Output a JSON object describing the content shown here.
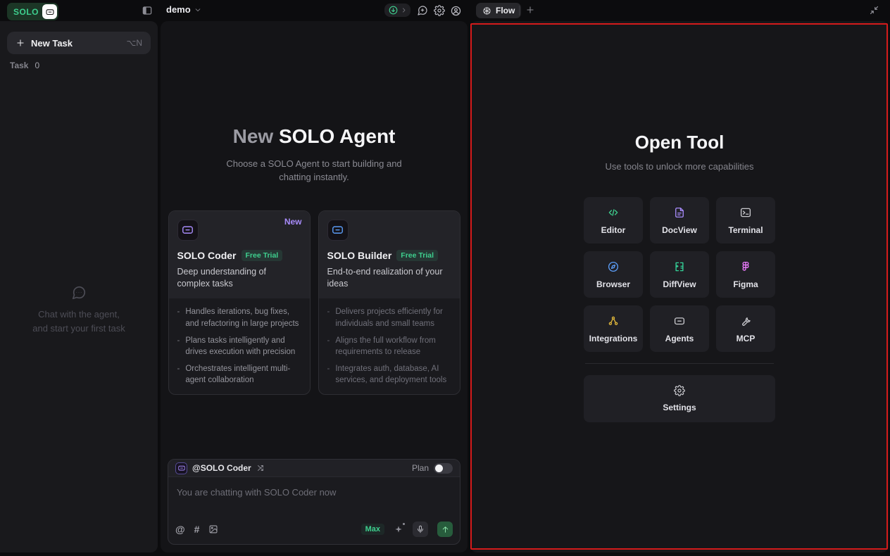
{
  "colors": {
    "accent_green": "#3ecf8e",
    "accent_purple": "#a78bfa",
    "accent_blue": "#5b9cf6",
    "highlight_red": "#d41b1b",
    "notification_blue": "#3b82f6"
  },
  "topbar": {
    "logo_text": "SOLO",
    "project_name": "demo"
  },
  "sidebar": {
    "new_task_label": "New Task",
    "new_task_shortcut": "⌥N",
    "task_label": "Task",
    "task_count": "0",
    "empty_line1": "Chat with the agent,",
    "empty_line2": "and start your first task"
  },
  "main": {
    "title_prefix": "New",
    "title_rest": "SOLO Agent",
    "subtitle": "Choose a SOLO Agent to start building and chatting instantly.",
    "agents": [
      {
        "name": "SOLO Coder",
        "badge": "New",
        "trial_label": "Free Trial",
        "description": "Deep understanding of complex tasks",
        "color": "#a78bfa",
        "bullets": [
          "Handles iterations, bug fixes, and refactoring in large projects",
          "Plans tasks intelligently and drives execution with precision",
          "Orchestrates intelligent multi-agent collaboration"
        ]
      },
      {
        "name": "SOLO Builder",
        "badge": "",
        "trial_label": "Free Trial",
        "description": "End-to-end realization of your ideas",
        "color": "#5b9cf6",
        "bullets": [
          "Delivers projects efficiently for individuals and small teams",
          "Aligns the full workflow from requirements to release",
          "Integrates auth, database, AI services, and deployment tools"
        ]
      }
    ]
  },
  "chat": {
    "agent_mention": "@SOLO Coder",
    "plan_label": "Plan",
    "placeholder": "You are chatting with SOLO Coder now",
    "at_glyph": "@",
    "hash_glyph": "#",
    "max_label": "Max"
  },
  "right_panel": {
    "tab_label": "Flow",
    "title": "Open Tool",
    "subtitle": "Use tools to unlock more capabilities",
    "tools": [
      {
        "label": "Editor",
        "icon": "code-icon",
        "color": "#3ecf8e"
      },
      {
        "label": "DocView",
        "icon": "document-icon",
        "color": "#a78bfa"
      },
      {
        "label": "Terminal",
        "icon": "terminal-icon",
        "color": "#c9c9ce"
      },
      {
        "label": "Browser",
        "icon": "compass-icon",
        "color": "#5b9cf6"
      },
      {
        "label": "DiffView",
        "icon": "diff-icon",
        "color": "#34d399"
      },
      {
        "label": "Figma",
        "icon": "figma-icon",
        "color": "#e879f9"
      },
      {
        "label": "Integrations",
        "icon": "nodes-icon",
        "color": "#e2b93b"
      },
      {
        "label": "Agents",
        "icon": "robot-icon",
        "color": "#c9c9ce"
      },
      {
        "label": "MCP",
        "icon": "wrench-icon",
        "color": "#c9c9ce"
      }
    ],
    "settings_label": "Settings"
  }
}
